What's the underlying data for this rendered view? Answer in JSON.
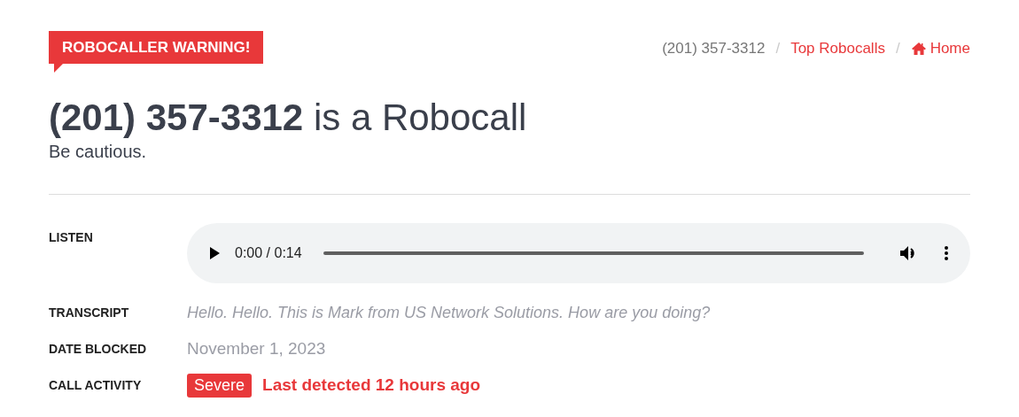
{
  "banner": {
    "label": "ROBOCALLER WARNING!"
  },
  "breadcrumb_separator": "/",
  "breadcrumb": [
    {
      "label": "(201) 357-3312",
      "kind": "current"
    },
    {
      "label": "Top Robocalls",
      "kind": "link"
    },
    {
      "label": "Home",
      "kind": "home"
    }
  ],
  "heading": "**(201) 357-3312** is a Robocall",
  "subheading": "Be cautious.",
  "details": [
    {
      "label": "LISTEN",
      "kind": "audio",
      "time": "0:00 / 0:14",
      "level": 0
    },
    {
      "label": "TRANSCRIPT",
      "kind": "quote",
      "value": "Hello. Hello. This is Mark from US Network Solutions. How are you doing?"
    },
    {
      "label": "DATE BLOCKED",
      "kind": "text",
      "value": "November 1, 2023"
    },
    {
      "label": "CALL ACTIVITY",
      "kind": "activity",
      "badge": "Severe",
      "value": "Last detected 12 hours ago"
    }
  ]
}
